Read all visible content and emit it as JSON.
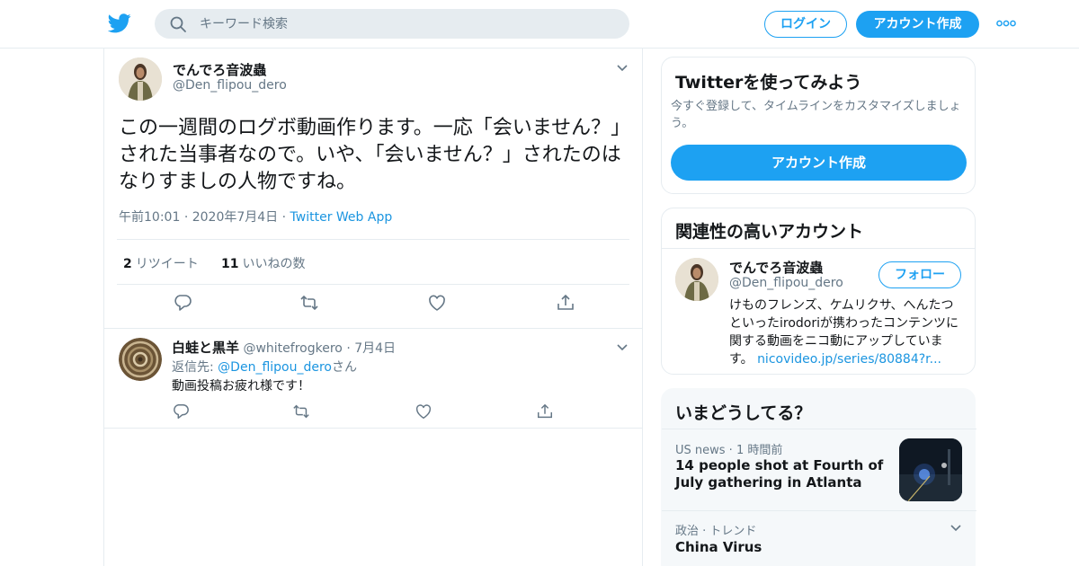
{
  "nav": {
    "search_placeholder": "キーワード検索",
    "login_label": "ログイン",
    "signup_label": "アカウント作成"
  },
  "colors": {
    "brand_blue": "#1da1f2",
    "link_blue": "#1b95e0",
    "secondary_text": "#657786",
    "border": "#e6ecf0"
  },
  "tweet": {
    "display_name": "でんでろ音波蟲",
    "handle": "@Den_flipou_dero",
    "text": "この一週間のログボ動画作ります。一応「会いません？」された当事者なので。いや、「会いません？」されたのはなりすましの人物ですね。",
    "time": "午前10:01",
    "date": "2020年7月4日",
    "source": "Twitter Web App",
    "retweet_count": "2",
    "retweet_label": "リツイート",
    "like_count": "11",
    "like_label": "いいねの数"
  },
  "reply": {
    "display_name": "白蛙と黒羊",
    "handle": "@whitefrogkero",
    "date": "7月4日",
    "reply_to_prefix": "返信先: ",
    "reply_to_handle": "@Den_flipou_dero",
    "reply_to_suffix": "さん",
    "text": "動画投稿お疲れ様です！"
  },
  "signup_card": {
    "title": "Twitterを使ってみよう",
    "subtitle": "今すぐ登録して、タイムラインをカスタマイズしましょう。",
    "button_label": "アカウント作成"
  },
  "related": {
    "title": "関連性の高いアカウント",
    "display_name": "でんでろ音波蟲",
    "handle": "@Den_flipou_dero",
    "follow_label": "フォロー",
    "bio": "けものフレンズ、ケムリクサ、へんたつといったirodoriが携わったコンテンツに関する動画をニコ動にアップしています。",
    "bio_link": "nicovideo.jp/series/80884?r..."
  },
  "trends": {
    "title": "いまどうしてる？",
    "items": [
      {
        "category": "US news",
        "time": "1 時間前",
        "headline": "14 people shot at Fourth of July gathering in Atlanta"
      },
      {
        "category": "政治",
        "label": "トレンド",
        "headline": "China Virus"
      }
    ]
  }
}
